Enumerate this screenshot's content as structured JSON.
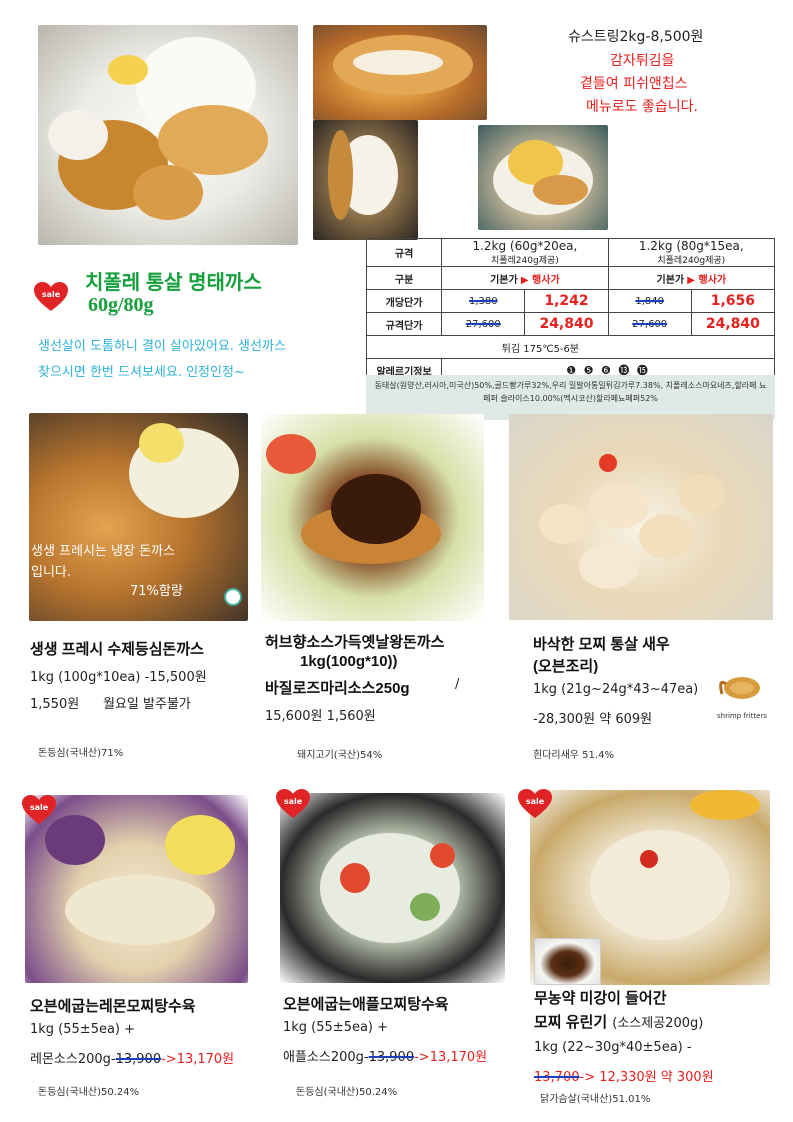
{
  "hero": {
    "strips_note": "슈스트링2kg-8,500원",
    "fries_note_1": "감자튀김을",
    "fries_note_2": "곁들여  피쉬앤칩스",
    "fries_note_3": "메뉴로도 좋습니다."
  },
  "featured": {
    "badge": "sale",
    "title": "치폴레 통살 명태까스",
    "size": "60g/80g",
    "desc_1": "생선살이 도톰하니 결이 살아있어요. 생선까스",
    "desc_2": "찾으시면 한번 드셔보세요. 인정인정~"
  },
  "price_table": {
    "row_spec_label": "규격",
    "col_a_title": "1.2kg (60g*20ea,",
    "col_a_sub": "치폴레240g제공)",
    "col_b_title": "1.2kg (80g*15ea,",
    "col_b_sub": "치폴레240g제공)",
    "row_kind_label": "구분",
    "kind_base": "기본가",
    "kind_event": "▶ 행사가",
    "row_unit_label": "개당단가",
    "a_unit_old": "1,380",
    "a_unit_new": "1,242",
    "b_unit_old": "1,840",
    "b_unit_new": "1,656",
    "row_spec_price_label": "규격단가",
    "a_spec_old": "27,600",
    "a_spec_new": "24,840",
    "b_spec_old": "27,600",
    "b_spec_new": "24,840",
    "fry_note": "튀김 175℃5-6분",
    "allergy_label": "알레르기정보",
    "allergy_codes": "❶ ❺ ❻ ⓭ ⓯",
    "ingredients": "동태살(원양산,러시아,미국산)50%,골드빵가루32%,우리  밀발아통밀튀김가루7.38%, 치폴레소스마요네즈,할라페  뇨 페퍼 슬라이스10.00%(멕시코산)할라페뇨페퍼52%"
  },
  "products": [
    {
      "overlay_1": "생생 프레시는 냉장 돈까스",
      "overlay_2": "입니다.",
      "overlay_3": "71%함량",
      "name": "생생 프레시 수제등심돈까스",
      "line_1": "1kg (100g*10ea) -15,500원",
      "price": "1,550원",
      "note": "월요일 발주불가",
      "origin": "돈등심(국내산)71%"
    },
    {
      "name_1": "허브향소스가득옛날왕돈까스",
      "name_2": "1kg(100g*10))",
      "name_3": "바질로즈마리소스250g",
      "slash": "/",
      "price": "15,600원 1,560원",
      "origin": "돼지고기(국산)54%"
    },
    {
      "name_1": "바삭한 모찌 통살 새우",
      "name_2": "(오븐조리)",
      "line_1": "1kg (21g~24g*43~47ea)",
      "price": "-28,300원 약 609원",
      "logo_text": "shrimp fritters",
      "origin": "흰다리새우 51.4%"
    },
    {
      "badge": "sale",
      "name": "오븐에굽는레몬모찌탕수육",
      "line_1": "1kg (55±5ea) +",
      "line_2_prefix": "레몬소스200g-",
      "price_old": "13,900",
      "price_new": "->13,170원",
      "origin": "돈등심(국내산)50.24%"
    },
    {
      "badge": "sale",
      "name": "오븐에굽는애플모찌탕수육",
      "line_1": "1kg (55±5ea) +",
      "line_2_prefix": "애플소스200g-",
      "price_old": "13,900",
      "price_new": "->13,170원",
      "origin": "돈등심(국내산)50.24%"
    },
    {
      "badge": "sale",
      "name_1": "무농약 미강이 들어간",
      "name_2": "모찌 유린기",
      "name_2_small": "(소스제공200g)",
      "line_1": "1kg (22~30g*40±5ea) -",
      "price_old": "13,700",
      "price_new": "-> 12,330원 약 300원",
      "origin": "닭가슴살(국내산)51.01%"
    }
  ]
}
